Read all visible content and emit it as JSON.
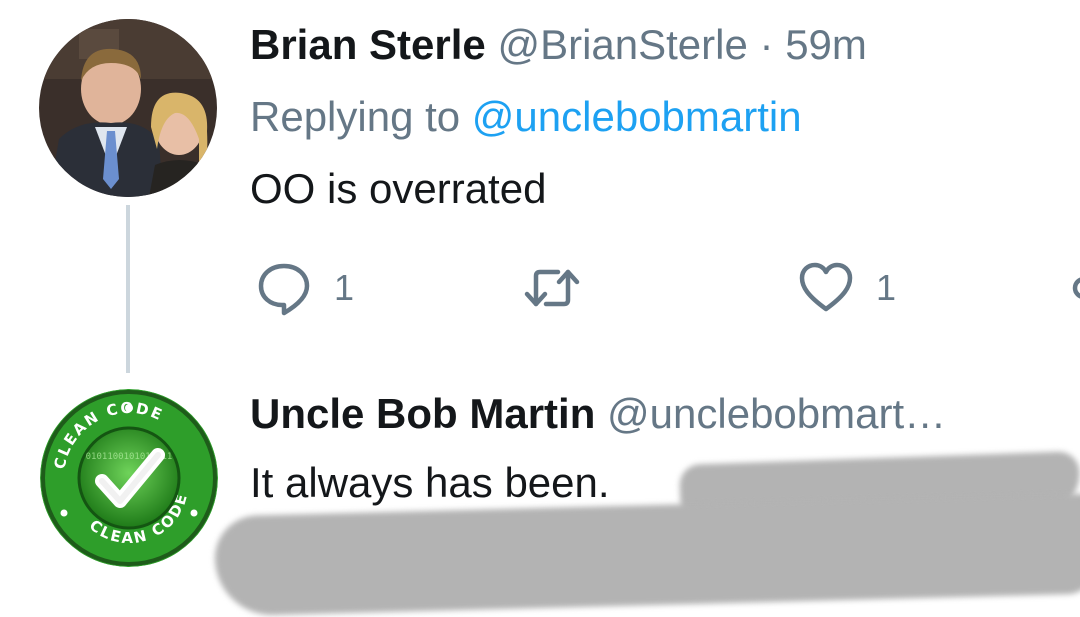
{
  "tweets": [
    {
      "name": "Brian Sterle",
      "handle": "@BrianSterle",
      "separator": "·",
      "time": "59m",
      "replying_prefix": "Replying to",
      "replying_to": "@unclebobmartin",
      "text": "OO is overrated",
      "actions": {
        "reply_count": "1",
        "like_count": "1"
      }
    },
    {
      "name": "Uncle Bob Martin",
      "handle": "@unclebobmart…",
      "text": "It always has been."
    }
  ],
  "avatar_badge": {
    "top_left": "CLEAN CODE",
    "top_right": "CLEAN CODE",
    "bottom": "CLEAN CODE",
    "binary": "0101100101010011"
  },
  "colors": {
    "text": "#14171a",
    "muted": "#657786",
    "link": "#1da1f2",
    "thread_line": "#ccd6dd",
    "badge_green": "#2e9e2a",
    "badge_dark": "#1e5c1a"
  },
  "icons": [
    "reply-icon",
    "retweet-icon",
    "like-icon",
    "share-icon"
  ]
}
